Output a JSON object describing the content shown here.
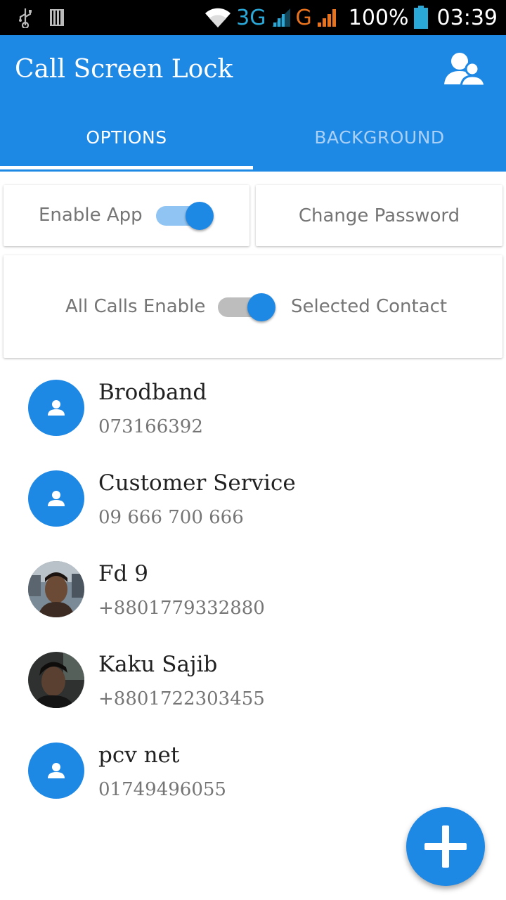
{
  "status_bar": {
    "net_3g": "3G",
    "net_g": "G",
    "battery": "100%",
    "time": "03:39"
  },
  "app_bar": {
    "title": "Call Screen Lock",
    "action_icon": "contacts-icon",
    "accent_color": "#1e88e5"
  },
  "tabs": [
    {
      "label": "OPTIONS",
      "active": true
    },
    {
      "label": "BACKGROUND",
      "active": false
    }
  ],
  "settings": {
    "enable_app_label": "Enable App",
    "enable_app_on": true,
    "change_password_label": "Change Password",
    "all_calls_label": "All Calls Enable",
    "selected_contact_label": "Selected Contact"
  },
  "contacts": [
    {
      "name": "Brodband",
      "number": "073166392",
      "avatar": "default"
    },
    {
      "name": "Customer Service",
      "number": "09 666 700 666",
      "avatar": "default"
    },
    {
      "name": "Fd 9",
      "number": "+8801779332880",
      "avatar": "photo"
    },
    {
      "name": "Kaku Sajib",
      "number": "+8801722303455",
      "avatar": "photo"
    },
    {
      "name": "pcv net",
      "number": "01749496055",
      "avatar": "default"
    }
  ],
  "fab": {
    "icon": "plus-icon"
  }
}
